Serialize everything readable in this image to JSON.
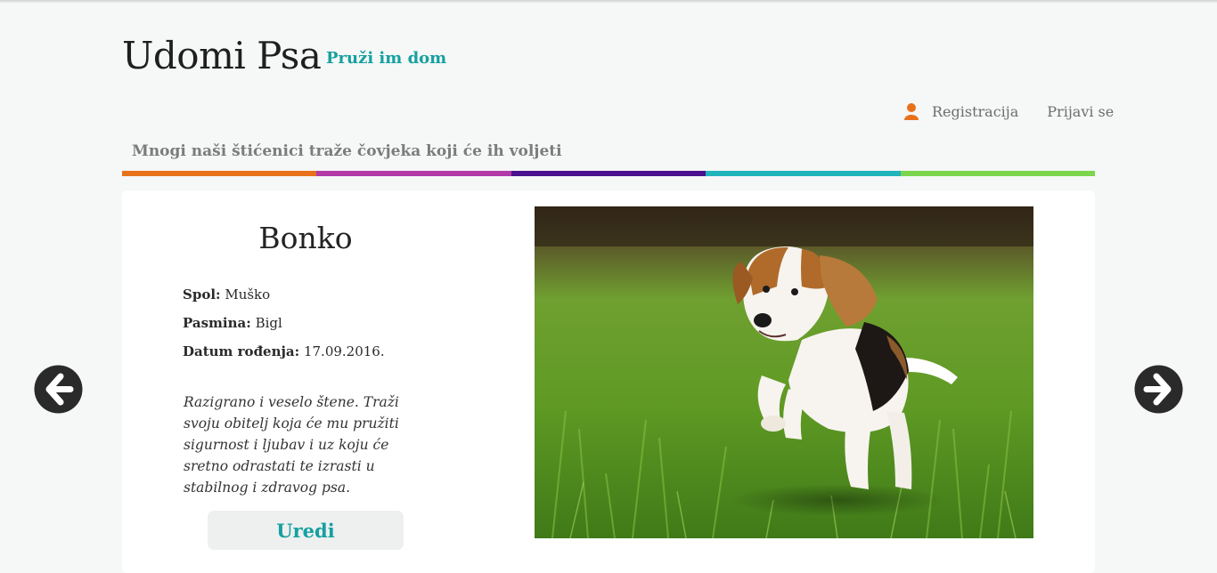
{
  "header": {
    "site_title": "Udomi Psa",
    "tagline": "Pruži im dom",
    "nav": {
      "register": "Registracija",
      "login": "Prijavi se",
      "register_icon": "user-icon"
    },
    "subtitle": "Mnogi naši štićenici traže čovjeka koji će ih voljeti",
    "stripe_colors": [
      "#e8721c",
      "#b23aa8",
      "#4a108e",
      "#22b3bb",
      "#7bd64e"
    ]
  },
  "dog": {
    "name": "Bonko",
    "facts": [
      {
        "label": "Spol:",
        "value": "Muško"
      },
      {
        "label": "Pasmina:",
        "value": "Bigl"
      },
      {
        "label": "Datum rođenja:",
        "value": "17.09.2016."
      }
    ],
    "description": "Razigrano i veselo štene. Traži svoju obitelj koja će mu pružiti sigurnost i ljubav i uz koju će sretno odrastati te izrasti u stabilnog i zdravog psa.",
    "edit_label": "Uredi",
    "photo_subject": "beagle puppy running on grass"
  },
  "navigation": {
    "prev_icon": "arrow-left-icon",
    "next_icon": "arrow-right-icon"
  },
  "colors": {
    "accent": "#16a0a0",
    "user_icon": "#e8721c",
    "arrow": "#2a2a2a"
  }
}
